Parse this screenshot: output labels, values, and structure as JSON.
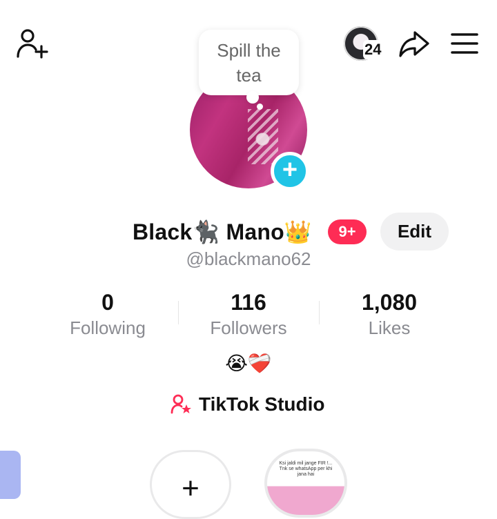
{
  "header": {
    "add_friend_icon": "person-plus-icon",
    "avatar_badge_count": "24",
    "share_icon": "share-arrow-icon",
    "menu_icon": "hamburger-menu-icon"
  },
  "bubble": {
    "text_line1": "Spill the",
    "text_line2": "tea"
  },
  "profile": {
    "display_name": "Black🐈‍⬛ Mano👑",
    "notification_badge": "9+",
    "edit_label": "Edit",
    "username": "@blackmano62",
    "bio": "😭❤️‍🩹"
  },
  "stats": {
    "following": {
      "value": "0",
      "label": "Following"
    },
    "followers": {
      "value": "116",
      "label": "Followers"
    },
    "likes": {
      "value": "1,080",
      "label": "Likes"
    }
  },
  "studio": {
    "label": "TikTok Studio"
  },
  "highlights": {
    "new_label": "+",
    "thumb_text": "Ksi jaldi mil jange FIR !... Tnk se whatsApp per khi jana hai"
  },
  "colors": {
    "accent": "#fe2c55",
    "cyan": "#20c4e6",
    "muted": "#8a8b91"
  }
}
